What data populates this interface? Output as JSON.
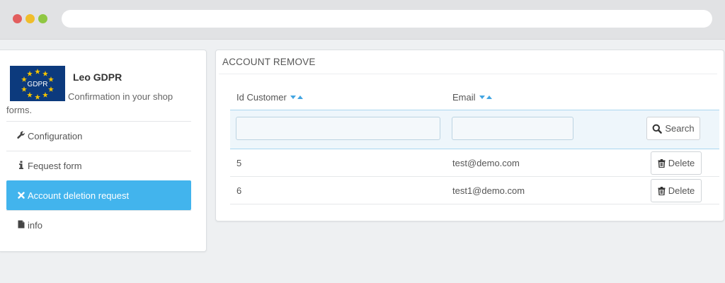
{
  "browser": {
    "window_buttons": [
      "close",
      "minimize",
      "maximize"
    ],
    "address_value": ""
  },
  "sidebar": {
    "module_name": "Leo GDPR",
    "module_description": "Confirmation in your shop forms.",
    "logo_text": "GDPR",
    "items": [
      {
        "label": "Configuration",
        "icon": "wrench-icon",
        "active": false
      },
      {
        "label": "Fequest form",
        "icon": "info-icon",
        "active": false
      },
      {
        "label": "Account deletion request",
        "icon": "close-icon",
        "active": true
      },
      {
        "label": "info",
        "icon": "file-icon",
        "active": false
      }
    ]
  },
  "panel": {
    "title": "ACCOUNT REMOVE",
    "columns": [
      "Id Customer",
      "Email"
    ],
    "filters": {
      "id_customer": "",
      "email": ""
    },
    "search_label": "Search",
    "rows": [
      {
        "id": "5",
        "email": "test@demo.com",
        "action": "Delete"
      },
      {
        "id": "6",
        "email": "test1@demo.com",
        "action": "Delete"
      }
    ]
  },
  "colors": {
    "accent": "#42b4ed",
    "sort_arrow": "#42a5e2",
    "filter_row_bg": "#eef6fb",
    "page_bg": "#eef0f2"
  }
}
